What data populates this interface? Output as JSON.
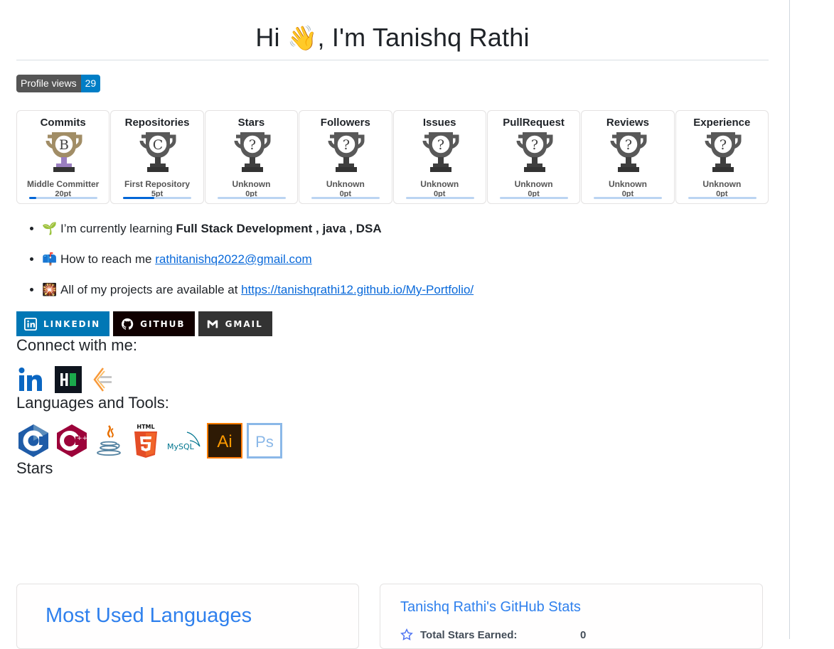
{
  "header": {
    "greeting": "Hi",
    "wave_emoji": "👋",
    "name": ", I'm Tanishq Rathi"
  },
  "profile_views": {
    "label": "Profile views",
    "count": "29"
  },
  "trophies": [
    {
      "title": "Commits",
      "rank": "B",
      "rank_label": "Middle Committer",
      "points": "20pt",
      "progress": 0.1,
      "color": "#a18d66"
    },
    {
      "title": "Repositories",
      "rank": "C",
      "rank_label": "First Repository",
      "points": "5pt",
      "progress": 0.45,
      "color": "#595959"
    },
    {
      "title": "Stars",
      "rank": "?",
      "rank_label": "Unknown",
      "points": "0pt",
      "progress": 0,
      "color": "#595959"
    },
    {
      "title": "Followers",
      "rank": "?",
      "rank_label": "Unknown",
      "points": "0pt",
      "progress": 0,
      "color": "#595959"
    },
    {
      "title": "Issues",
      "rank": "?",
      "rank_label": "Unknown",
      "points": "0pt",
      "progress": 0,
      "color": "#595959"
    },
    {
      "title": "PullRequest",
      "rank": "?",
      "rank_label": "Unknown",
      "points": "0pt",
      "progress": 0,
      "color": "#595959"
    },
    {
      "title": "Reviews",
      "rank": "?",
      "rank_label": "Unknown",
      "points": "0pt",
      "progress": 0,
      "color": "#595959"
    },
    {
      "title": "Experience",
      "rank": "?",
      "rank_label": "Unknown",
      "points": "0pt",
      "progress": 0,
      "color": "#595959"
    }
  ],
  "info": {
    "learning": {
      "emoji": "🌱",
      "text": "I’m currently learning ",
      "strong": "Full Stack Development , java , DSA"
    },
    "reach": {
      "emoji": "📫",
      "text": "How to reach me ",
      "link": "rathitanishq2022@gmail.com"
    },
    "projects": {
      "emoji": "🎇",
      "text": "All of my projects are available at ",
      "link": "https://tanishqrathi12.github.io/My-Portfolio/"
    }
  },
  "social_buttons": {
    "linkedin": {
      "label": "LINKEDIN",
      "color": "#0077b5"
    },
    "github": {
      "label": "GITHUB",
      "color": "#100000"
    },
    "gmail": {
      "label": "GMAIL",
      "color": "#333333"
    }
  },
  "connect": {
    "heading": "Connect with me:",
    "icons": [
      "linkedin-icon",
      "hackerrank-icon",
      "codesignal-icon"
    ]
  },
  "tools": {
    "heading": "Languages and Tools:",
    "icons": [
      "c-icon",
      "cplusplus-icon",
      "java-icon",
      "html5-icon",
      "mysql-icon",
      "illustrator-icon",
      "photoshop-icon"
    ],
    "html_label": "HTML",
    "mysql_label": "MySQL"
  },
  "stars": {
    "heading": "Stars"
  },
  "languages_card": {
    "title": "Most Used Languages"
  },
  "stats_card": {
    "title": "Tanishq Rathi's GitHub Stats",
    "row_label": "Total Stars Earned:",
    "row_value": "0"
  }
}
